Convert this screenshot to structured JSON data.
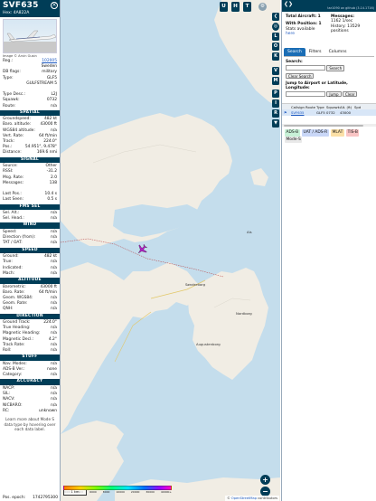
{
  "info": {
    "callsign": "SVF635",
    "hex_label": "Hex:",
    "hex_value": "4A822A",
    "photo_credit": "Image © Arvin Gusin",
    "basic": [
      {
        "k": "Reg.:",
        "v": "102005",
        "link": true
      },
      {
        "k": "",
        "v": "Sweden",
        "link": false
      },
      {
        "k": "DB flags:",
        "v": "military",
        "link": false
      },
      {
        "k": "Type:",
        "v": "GLF5",
        "link": false
      },
      {
        "k": "",
        "v": "GULFSTREAM 5",
        "link": false
      },
      {
        "k": "",
        "v": "",
        "link": false
      },
      {
        "k": "Type Desc.:",
        "v": "L2J",
        "link": false
      },
      {
        "k": "Squawk:",
        "v": "0732",
        "link": false
      },
      {
        "k": "Route:",
        "v": "n/a",
        "link": false
      }
    ],
    "sections": [
      {
        "title": "SPATIAL",
        "rows": [
          {
            "k": "Groundspeed:",
            "v": "482 kt"
          },
          {
            "k": "Baro. altitude:",
            "v": "43000 ft"
          },
          {
            "k": "WGS84 altitude:",
            "v": "n/a"
          },
          {
            "k": "Vert. Rate:",
            "v": "64 ft/min"
          },
          {
            "k": "Track:",
            "v": "224.0°"
          },
          {
            "k": "Pos.:",
            "v": "54.951°, 9.478°"
          },
          {
            "k": "Distance:",
            "v": "169.6 nmi"
          }
        ]
      },
      {
        "title": "SIGNAL",
        "rows": [
          {
            "k": "Source:",
            "v": "Other"
          },
          {
            "k": "RSSI:",
            "v": "-31.2"
          },
          {
            "k": "Msg. Rate:",
            "v": "2.0"
          },
          {
            "k": "Messages:",
            "v": "138"
          },
          {
            "k": "",
            "v": ""
          },
          {
            "k": "Last Pos.:",
            "v": "10.4 s"
          },
          {
            "k": "Last Seen:",
            "v": "0.5 s"
          }
        ]
      },
      {
        "title": "FMS SEL",
        "rows": [
          {
            "k": "Sel. Alt.:",
            "v": "n/a"
          },
          {
            "k": "Sel. Head.:",
            "v": "n/a"
          }
        ]
      },
      {
        "title": "WIND",
        "rows": [
          {
            "k": "Speed:",
            "v": "n/a"
          },
          {
            "k": "Direction (from):",
            "v": "n/a"
          },
          {
            "k": "TAT / OAT:",
            "v": "n/a"
          }
        ]
      },
      {
        "title": "SPEED",
        "rows": [
          {
            "k": "Ground:",
            "v": "482 kt"
          },
          {
            "k": "True:",
            "v": "n/a"
          },
          {
            "k": "Indicated:",
            "v": "n/a"
          },
          {
            "k": "Mach:",
            "v": "n/a"
          }
        ]
      },
      {
        "title": "ALTITUDE",
        "rows": [
          {
            "k": "Barometric:",
            "v": "43000 ft"
          },
          {
            "k": "Baro. Rate:",
            "v": "64 ft/min"
          },
          {
            "k": "Geom. WGS84:",
            "v": "n/a"
          },
          {
            "k": "Geom. Rate:",
            "v": "n/a"
          },
          {
            "k": "QNH:",
            "v": "n/a"
          }
        ]
      },
      {
        "title": "DIRECTION",
        "rows": [
          {
            "k": "Ground Track:",
            "v": "224.0°"
          },
          {
            "k": "True Heading:",
            "v": "n/a"
          },
          {
            "k": "Magnetic Heading:",
            "v": "n/a"
          },
          {
            "k": "Magnetic Decl.:",
            "v": "4.2°"
          },
          {
            "k": "Track Rate:",
            "v": "n/a"
          },
          {
            "k": "Roll:",
            "v": "n/a"
          }
        ]
      },
      {
        "title": "STUFF",
        "rows": [
          {
            "k": "Nav. Modes:",
            "v": "n/a"
          },
          {
            "k": "ADS-B Ver.:",
            "v": "none"
          },
          {
            "k": "Category:",
            "v": "n/a"
          }
        ]
      },
      {
        "title": "ACCURACY",
        "rows": [
          {
            "k": "NACP:",
            "v": "n/a"
          },
          {
            "k": "SIL:",
            "v": "n/a"
          },
          {
            "k": "NACV:",
            "v": "n/a"
          },
          {
            "k": "NICBARO:",
            "v": "n/a"
          },
          {
            "k": "RC:",
            "v": "unknown"
          }
        ]
      }
    ],
    "footnote": "Learn more about Mode S data type by hovering over each data label.",
    "epoch_label": "Pos. epoch:",
    "epoch_value": "1742795300"
  },
  "map": {
    "top_buttons": [
      "U",
      "H",
      "T"
    ],
    "side_buttons": [
      "L",
      "O",
      "K",
      "V",
      "M",
      "P",
      "I",
      "R"
    ],
    "zoom_in": "+",
    "zoom_out": "−",
    "scale": "1 km",
    "legend_ticks": [
      "2000",
      "4000",
      "6000",
      "8000",
      "10000",
      "20000",
      "30000",
      "40000+"
    ],
    "attribution_prefix": "©",
    "attribution_link": "OpenStreetMap",
    "attribution_suffix": "contributors",
    "places": [
      "Als",
      "Sønderborg",
      "Nordborg",
      "Augustenborg"
    ],
    "aircraft_color": "#b31cc7"
  },
  "panel": {
    "version": "tar1090 on github (3.14.1716)",
    "total_label": "Total Aircraft:",
    "total_value": "1",
    "withpos_label": "With Position:",
    "withpos_value": "1",
    "stats_label": "Stats available",
    "stats_link": "here",
    "messages_label": "Messages:",
    "messages_value": "1162 1/sec",
    "history_label": "History: 13529 positions",
    "tabs": [
      "Search",
      "Filters",
      "Columns"
    ],
    "search_label": "Search:",
    "search_button": "Search",
    "clear_search_button": "Clear Search",
    "jump_label": "Jump to Airport or Latitude, Longitude:",
    "jump_button": "Jump",
    "clear_button": "Clear",
    "table_headers": [
      "",
      "Callsign",
      "Route",
      "Type",
      "Squawk",
      "Alt. (ft)",
      "Spd"
    ],
    "table_rows": [
      [
        "",
        "SVF635",
        "",
        "GLF5",
        "0732",
        "43000",
        ""
      ]
    ],
    "source_chips": [
      "ADS-B",
      "UAT / ADS-R",
      "MLAT",
      "TIS-B",
      "Mode-S"
    ]
  }
}
